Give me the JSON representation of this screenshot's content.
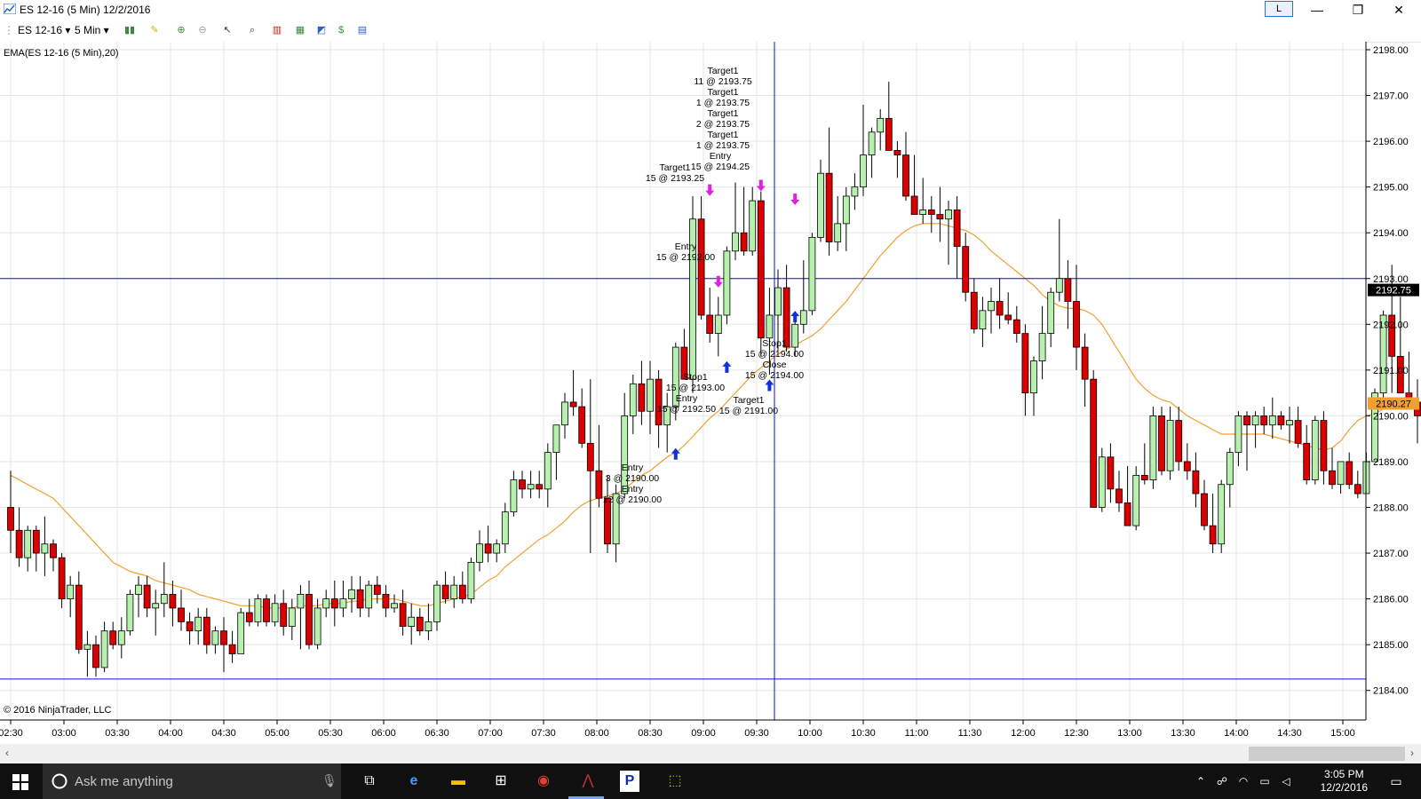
{
  "window": {
    "title": "ES 12-16 (5 Min)  12/2/2016",
    "layout_button": "L",
    "minimize": "—",
    "maximize": "❐",
    "close": "✕"
  },
  "toolbar": {
    "instrument": "ES 12-16 ▾",
    "interval": "5 Min ▾"
  },
  "indicator_label": "EMA(ES 12-16 (5 Min),20)",
  "copyright": "© 2016 NinjaTrader, LLC",
  "price_axis": {
    "labels": [
      "2198.00",
      "2197.00",
      "2196.00",
      "2195.00",
      "2194.00",
      "2193.00",
      "2192.00",
      "2191.00",
      "2190.00",
      "2189.00",
      "2188.00",
      "2187.00",
      "2186.00",
      "2185.00",
      "2184.00"
    ]
  },
  "time_axis": {
    "labels": [
      "02:30",
      "03:00",
      "03:30",
      "04:00",
      "04:30",
      "05:00",
      "05:30",
      "06:00",
      "06:30",
      "07:00",
      "07:30",
      "08:00",
      "08:30",
      "09:00",
      "09:30",
      "10:00",
      "10:30",
      "11:00",
      "11:30",
      "12:00",
      "12:30",
      "13:00",
      "13:30",
      "14:00",
      "14:30",
      "15:00"
    ]
  },
  "last_price_tag": "2192.75",
  "ema_value_tag": "2190.27",
  "crosshair": {
    "price": 2193.0,
    "time": "09:40"
  },
  "trade_labels": [
    "Target1",
    "11 @ 2193.75",
    "Target1",
    "1 @ 2193.75",
    "Target1",
    "2 @ 2193.75",
    "Target1",
    "1 @ 2193.75",
    "Entry",
    "15 @ 2194.25",
    "Target1",
    "15 @ 2193.25",
    "Entry",
    "15 @ 2192.00",
    "Stop1",
    "15 @ 2193.00",
    "Entry",
    "15 @ 2192.50",
    "Target1",
    "15 @ 2191.00",
    "Stop1",
    "15 @ 2194.00",
    "Close",
    "15 @ 2194.00",
    "Entry",
    "3 @ 2190.00",
    "Entry",
    "12 @ 2190.00"
  ],
  "taskbar": {
    "search_placeholder": "Ask me anything",
    "time": "3:05 PM",
    "date": "12/2/2016"
  },
  "colors": {
    "up_candle": "#b8f0b0",
    "down_candle": "#dd0000",
    "ema": "#f0a030",
    "crosshair": "#1010d0",
    "buy_arrow": "#1030e0",
    "sell_arrow": "#e020e0"
  },
  "chart_data": {
    "type": "candlestick",
    "ylim": [
      2183.6,
      2198.0
    ],
    "interval": "5 Min",
    "candles": [
      [
        2188.0,
        2188.8,
        2187.0,
        2187.5
      ],
      [
        2187.5,
        2188.0,
        2186.7,
        2186.9
      ],
      [
        2186.9,
        2187.6,
        2186.6,
        2187.5
      ],
      [
        2187.5,
        2187.6,
        2186.6,
        2187.0
      ],
      [
        2187.0,
        2187.8,
        2186.5,
        2187.2
      ],
      [
        2187.2,
        2187.3,
        2186.6,
        2186.9
      ],
      [
        2186.9,
        2187.0,
        2185.8,
        2186.0
      ],
      [
        2186.0,
        2186.5,
        2185.6,
        2186.3
      ],
      [
        2186.3,
        2186.6,
        2184.8,
        2184.9
      ],
      [
        2184.9,
        2185.3,
        2184.3,
        2185.0
      ],
      [
        2185.0,
        2185.2,
        2184.3,
        2184.5
      ],
      [
        2184.5,
        2185.5,
        2184.4,
        2185.3
      ],
      [
        2185.3,
        2185.5,
        2184.9,
        2185.0
      ],
      [
        2185.0,
        2185.6,
        2184.7,
        2185.3
      ],
      [
        2185.3,
        2186.2,
        2185.2,
        2186.1
      ],
      [
        2186.1,
        2186.5,
        2185.6,
        2186.3
      ],
      [
        2186.3,
        2186.5,
        2185.6,
        2185.8
      ],
      [
        2185.8,
        2186.2,
        2185.2,
        2185.9
      ],
      [
        2185.9,
        2186.8,
        2185.6,
        2186.1
      ],
      [
        2186.1,
        2186.4,
        2185.4,
        2185.8
      ],
      [
        2185.8,
        2186.2,
        2185.3,
        2185.5
      ],
      [
        2185.5,
        2185.7,
        2185.0,
        2185.3
      ],
      [
        2185.3,
        2185.8,
        2185.0,
        2185.6
      ],
      [
        2185.6,
        2185.8,
        2184.8,
        2185.0
      ],
      [
        2185.0,
        2185.4,
        2184.8,
        2185.3
      ],
      [
        2185.3,
        2185.6,
        2184.4,
        2185.0
      ],
      [
        2185.0,
        2185.3,
        2184.6,
        2184.8
      ],
      [
        2184.8,
        2185.8,
        2184.8,
        2185.7
      ],
      [
        2185.7,
        2186.0,
        2185.4,
        2185.5
      ],
      [
        2185.5,
        2186.1,
        2185.4,
        2186.0
      ],
      [
        2186.0,
        2186.1,
        2185.4,
        2185.5
      ],
      [
        2185.5,
        2186.1,
        2185.4,
        2185.9
      ],
      [
        2185.9,
        2186.2,
        2185.2,
        2185.4
      ],
      [
        2185.4,
        2186.0,
        2185.1,
        2185.8
      ],
      [
        2185.8,
        2186.3,
        2184.9,
        2186.1
      ],
      [
        2186.1,
        2186.4,
        2184.9,
        2185.0
      ],
      [
        2185.0,
        2186.0,
        2184.9,
        2185.8
      ],
      [
        2185.8,
        2186.2,
        2185.6,
        2186.0
      ],
      [
        2186.0,
        2186.4,
        2185.4,
        2185.8
      ],
      [
        2185.8,
        2186.4,
        2185.6,
        2186.0
      ],
      [
        2186.0,
        2186.5,
        2185.7,
        2186.2
      ],
      [
        2186.2,
        2186.5,
        2185.6,
        2185.8
      ],
      [
        2185.8,
        2186.4,
        2185.6,
        2186.3
      ],
      [
        2186.3,
        2186.5,
        2185.9,
        2186.1
      ],
      [
        2186.1,
        2186.3,
        2185.6,
        2185.8
      ],
      [
        2185.8,
        2186.1,
        2185.7,
        2185.9
      ],
      [
        2185.9,
        2186.2,
        2185.2,
        2185.4
      ],
      [
        2185.4,
        2185.9,
        2185.0,
        2185.6
      ],
      [
        2185.6,
        2185.8,
        2185.2,
        2185.3
      ],
      [
        2185.3,
        2185.9,
        2185.1,
        2185.5
      ],
      [
        2185.5,
        2186.4,
        2185.3,
        2186.3
      ],
      [
        2186.3,
        2186.6,
        2185.9,
        2186.0
      ],
      [
        2186.0,
        2186.5,
        2185.8,
        2186.3
      ],
      [
        2186.3,
        2186.6,
        2185.9,
        2186.0
      ],
      [
        2186.0,
        2186.9,
        2185.9,
        2186.8
      ],
      [
        2186.8,
        2187.5,
        2186.6,
        2187.2
      ],
      [
        2187.2,
        2187.6,
        2186.8,
        2187.0
      ],
      [
        2187.0,
        2187.3,
        2186.8,
        2187.2
      ],
      [
        2187.2,
        2188.1,
        2187.0,
        2187.9
      ],
      [
        2187.9,
        2188.8,
        2187.8,
        2188.6
      ],
      [
        2188.6,
        2188.8,
        2188.2,
        2188.4
      ],
      [
        2188.4,
        2188.8,
        2188.2,
        2188.5
      ],
      [
        2188.5,
        2188.8,
        2188.2,
        2188.4
      ],
      [
        2188.4,
        2189.4,
        2188.0,
        2189.2
      ],
      [
        2189.2,
        2189.8,
        2188.6,
        2189.8
      ],
      [
        2189.8,
        2190.5,
        2189.5,
        2190.3
      ],
      [
        2190.3,
        2191.0,
        2190.0,
        2190.2
      ],
      [
        2190.2,
        2190.6,
        2189.3,
        2189.4
      ],
      [
        2189.4,
        2190.8,
        2187.0,
        2188.8
      ],
      [
        2188.8,
        2189.8,
        2188.0,
        2188.2
      ],
      [
        2188.2,
        2188.7,
        2187.0,
        2187.2
      ],
      [
        2187.2,
        2188.5,
        2186.8,
        2188.3
      ],
      [
        2188.3,
        2190.5,
        2188.2,
        2190.0
      ],
      [
        2190.0,
        2190.9,
        2189.6,
        2190.7
      ],
      [
        2190.7,
        2191.2,
        2189.8,
        2190.1
      ],
      [
        2190.1,
        2191.2,
        2189.6,
        2190.8
      ],
      [
        2190.8,
        2191.0,
        2189.3,
        2189.8
      ],
      [
        2189.8,
        2190.5,
        2189.2,
        2190.2
      ],
      [
        2190.2,
        2191.6,
        2189.9,
        2191.5
      ],
      [
        2191.5,
        2191.9,
        2190.8,
        2190.8
      ],
      [
        2190.8,
        2194.8,
        2190.5,
        2194.3
      ],
      [
        2194.3,
        2194.8,
        2192.1,
        2192.2
      ],
      [
        2192.2,
        2192.8,
        2191.6,
        2191.8
      ],
      [
        2191.8,
        2192.6,
        2191.3,
        2192.2
      ],
      [
        2192.2,
        2193.7,
        2192.0,
        2193.6
      ],
      [
        2193.6,
        2195.1,
        2193.4,
        2194.0
      ],
      [
        2194.0,
        2195.0,
        2193.5,
        2193.6
      ],
      [
        2193.6,
        2195.0,
        2193.5,
        2194.7
      ],
      [
        2194.7,
        2194.9,
        2191.3,
        2191.7
      ],
      [
        2191.7,
        2192.8,
        2190.9,
        2192.2
      ],
      [
        2192.2,
        2193.2,
        2191.4,
        2192.8
      ],
      [
        2192.8,
        2193.3,
        2191.4,
        2191.5
      ],
      [
        2191.5,
        2192.2,
        2191.3,
        2192.0
      ],
      [
        2192.0,
        2193.4,
        2191.8,
        2192.3
      ],
      [
        2192.3,
        2194.0,
        2192.2,
        2193.9
      ],
      [
        2193.9,
        2195.6,
        2193.8,
        2195.3
      ],
      [
        2195.3,
        2196.3,
        2193.5,
        2193.8
      ],
      [
        2193.8,
        2194.8,
        2193.6,
        2194.2
      ],
      [
        2194.2,
        2195.0,
        2193.6,
        2194.8
      ],
      [
        2194.8,
        2195.3,
        2194.5,
        2195.0
      ],
      [
        2195.0,
        2196.8,
        2194.8,
        2195.7
      ],
      [
        2195.7,
        2196.3,
        2195.2,
        2196.2
      ],
      [
        2196.2,
        2196.7,
        2195.8,
        2196.5
      ],
      [
        2196.5,
        2197.3,
        2195.8,
        2195.8
      ],
      [
        2195.8,
        2196.0,
        2195.2,
        2195.7
      ],
      [
        2195.7,
        2196.2,
        2194.7,
        2194.8
      ],
      [
        2194.8,
        2195.7,
        2194.5,
        2194.4
      ],
      [
        2194.4,
        2195.2,
        2194.2,
        2194.5
      ],
      [
        2194.5,
        2194.8,
        2194.0,
        2194.4
      ],
      [
        2194.4,
        2195.0,
        2193.8,
        2194.3
      ],
      [
        2194.3,
        2194.7,
        2193.3,
        2194.5
      ],
      [
        2194.5,
        2194.8,
        2193.0,
        2193.7
      ],
      [
        2193.7,
        2194.0,
        2192.5,
        2192.7
      ],
      [
        2192.7,
        2193.0,
        2191.8,
        2191.9
      ],
      [
        2191.9,
        2192.6,
        2191.5,
        2192.3
      ],
      [
        2192.3,
        2192.8,
        2191.8,
        2192.5
      ],
      [
        2192.5,
        2193.0,
        2191.9,
        2192.2
      ],
      [
        2192.2,
        2192.7,
        2192.0,
        2192.1
      ],
      [
        2192.1,
        2192.4,
        2191.6,
        2191.8
      ],
      [
        2191.8,
        2192.0,
        2190.0,
        2190.5
      ],
      [
        2190.5,
        2191.3,
        2190.0,
        2191.2
      ],
      [
        2191.2,
        2192.4,
        2190.8,
        2191.8
      ],
      [
        2191.8,
        2192.8,
        2191.5,
        2192.7
      ],
      [
        2192.7,
        2194.3,
        2192.5,
        2193.0
      ],
      [
        2193.0,
        2193.4,
        2191.9,
        2192.5
      ],
      [
        2192.5,
        2193.3,
        2191.0,
        2191.5
      ],
      [
        2191.5,
        2191.8,
        2190.2,
        2190.8
      ],
      [
        2190.8,
        2191.0,
        2188.0,
        2188.0
      ],
      [
        2188.0,
        2189.3,
        2187.9,
        2189.1
      ],
      [
        2189.1,
        2189.4,
        2188.1,
        2188.4
      ],
      [
        2188.4,
        2188.8,
        2187.9,
        2188.1
      ],
      [
        2188.1,
        2188.9,
        2187.6,
        2187.6
      ],
      [
        2187.6,
        2188.9,
        2187.5,
        2188.7
      ],
      [
        2188.7,
        2189.4,
        2188.5,
        2188.6
      ],
      [
        2188.6,
        2190.2,
        2188.4,
        2190.0
      ],
      [
        2190.0,
        2190.2,
        2188.7,
        2188.8
      ],
      [
        2188.8,
        2190.2,
        2188.6,
        2189.9
      ],
      [
        2189.9,
        2190.2,
        2188.8,
        2189.0
      ],
      [
        2189.0,
        2189.4,
        2188.6,
        2188.8
      ],
      [
        2188.8,
        2189.2,
        2188.0,
        2188.3
      ],
      [
        2188.3,
        2188.6,
        2187.5,
        2187.6
      ],
      [
        2187.6,
        2188.3,
        2187.0,
        2187.2
      ],
      [
        2187.2,
        2188.6,
        2187.0,
        2188.5
      ],
      [
        2188.5,
        2189.3,
        2188.0,
        2189.2
      ],
      [
        2189.2,
        2190.1,
        2188.9,
        2190.0
      ],
      [
        2190.0,
        2190.1,
        2188.8,
        2189.8
      ],
      [
        2189.8,
        2190.1,
        2189.3,
        2190.0
      ],
      [
        2190.0,
        2190.2,
        2189.6,
        2189.8
      ],
      [
        2189.8,
        2190.4,
        2189.5,
        2190.0
      ],
      [
        2190.0,
        2190.1,
        2189.7,
        2189.8
      ],
      [
        2189.8,
        2190.2,
        2189.4,
        2189.9
      ],
      [
        2189.9,
        2190.2,
        2189.3,
        2189.4
      ],
      [
        2189.4,
        2189.8,
        2188.5,
        2188.6
      ],
      [
        2188.6,
        2190.0,
        2188.5,
        2189.9
      ],
      [
        2189.9,
        2190.1,
        2188.5,
        2188.8
      ],
      [
        2188.8,
        2189.3,
        2188.4,
        2188.5
      ],
      [
        2188.5,
        2189.0,
        2188.3,
        2189.0
      ],
      [
        2189.0,
        2189.2,
        2188.4,
        2188.5
      ],
      [
        2188.5,
        2188.8,
        2188.2,
        2188.3
      ],
      [
        2188.3,
        2189.2,
        2188.3,
        2189.0
      ],
      [
        2189.0,
        2190.6,
        2189.0,
        2190.5
      ],
      [
        2190.5,
        2192.3,
        2190.3,
        2192.2
      ],
      [
        2192.2,
        2193.3,
        2190.5,
        2191.3
      ],
      [
        2191.3,
        2192.6,
        2190.5,
        2190.5
      ],
      [
        2190.5,
        2191.4,
        2190.2,
        2190.3
      ],
      [
        2190.3,
        2190.8,
        2189.4,
        2190.0
      ],
      [
        2190.0,
        2191.2,
        2189.8,
        2190.5
      ],
      [
        2190.5,
        2191.4,
        2189.8,
        2191.0
      ],
      [
        2191.0,
        2192.8,
        2190.9,
        2192.7
      ]
    ],
    "ema20": [
      2188.7,
      2188.6,
      2188.5,
      2188.4,
      2188.3,
      2188.2,
      2188.0,
      2187.8,
      2187.6,
      2187.4,
      2187.2,
      2187.0,
      2186.8,
      2186.7,
      2186.6,
      2186.55,
      2186.5,
      2186.4,
      2186.35,
      2186.3,
      2186.25,
      2186.2,
      2186.1,
      2186.05,
      2186.0,
      2185.95,
      2185.9,
      2185.85,
      2185.85,
      2185.85,
      2185.8,
      2185.8,
      2185.8,
      2185.8,
      2185.85,
      2185.85,
      2185.85,
      2185.9,
      2185.9,
      2185.9,
      2185.95,
      2185.95,
      2186.0,
      2186.0,
      2186.0,
      2186.0,
      2185.95,
      2185.9,
      2185.85,
      2185.85,
      2185.9,
      2185.95,
      2186.0,
      2186.05,
      2186.1,
      2186.25,
      2186.4,
      2186.5,
      2186.7,
      2186.85,
      2187.0,
      2187.15,
      2187.3,
      2187.4,
      2187.55,
      2187.7,
      2187.9,
      2188.05,
      2188.15,
      2188.2,
      2188.25,
      2188.3,
      2188.4,
      2188.55,
      2188.7,
      2188.8,
      2188.95,
      2189.1,
      2189.2,
      2189.35,
      2189.55,
      2189.75,
      2189.95,
      2190.1,
      2190.3,
      2190.5,
      2190.7,
      2190.9,
      2191.05,
      2191.2,
      2191.35,
      2191.45,
      2191.55,
      2191.65,
      2191.75,
      2191.9,
      2192.1,
      2192.3,
      2192.5,
      2192.75,
      2193.0,
      2193.25,
      2193.5,
      2193.7,
      2193.9,
      2194.05,
      2194.15,
      2194.2,
      2194.2,
      2194.2,
      2194.15,
      2194.1,
      2194.05,
      2193.95,
      2193.8,
      2193.6,
      2193.45,
      2193.3,
      2193.15,
      2193.0,
      2192.85,
      2192.65,
      2192.5,
      2192.4,
      2192.35,
      2192.35,
      2192.3,
      2192.2,
      2192.0,
      2191.7,
      2191.4,
      2191.1,
      2190.8,
      2190.6,
      2190.45,
      2190.35,
      2190.3,
      2190.15,
      2190.0,
      2189.9,
      2189.8,
      2189.7,
      2189.6,
      2189.6,
      2189.6,
      2189.6,
      2189.6,
      2189.6,
      2189.55,
      2189.5,
      2189.45,
      2189.4,
      2189.35,
      2189.3,
      2189.25,
      2189.3,
      2189.45,
      2189.7,
      2189.9,
      2190.0,
      2190.05,
      2190.15,
      2190.2,
      2190.3
    ],
    "markers": [
      {
        "type": "buy",
        "index": 78,
        "price": 2189.1
      },
      {
        "type": "buy",
        "index": 84,
        "price": 2191.0
      },
      {
        "type": "buy",
        "index": 89,
        "price": 2190.6
      },
      {
        "type": "buy",
        "index": 92,
        "price": 2192.1
      },
      {
        "type": "sell",
        "index": 82,
        "price": 2195.0
      },
      {
        "type": "sell",
        "index": 88,
        "price": 2195.1
      },
      {
        "type": "sell",
        "index": 92,
        "price": 2194.8
      },
      {
        "type": "sell",
        "index": 83,
        "price": 2193.0
      }
    ]
  }
}
